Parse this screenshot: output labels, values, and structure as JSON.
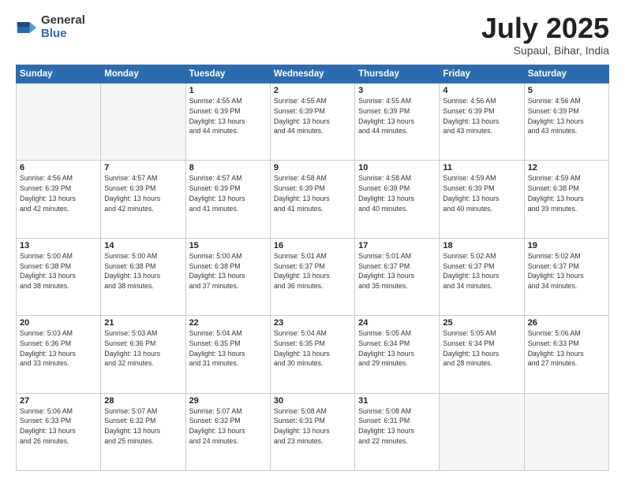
{
  "logo": {
    "general": "General",
    "blue": "Blue"
  },
  "title": {
    "month": "July 2025",
    "location": "Supaul, Bihar, India"
  },
  "weekdays": [
    "Sunday",
    "Monday",
    "Tuesday",
    "Wednesday",
    "Thursday",
    "Friday",
    "Saturday"
  ],
  "weeks": [
    [
      {
        "day": "",
        "info": ""
      },
      {
        "day": "",
        "info": ""
      },
      {
        "day": "1",
        "info": "Sunrise: 4:55 AM\nSunset: 6:39 PM\nDaylight: 13 hours\nand 44 minutes."
      },
      {
        "day": "2",
        "info": "Sunrise: 4:55 AM\nSunset: 6:39 PM\nDaylight: 13 hours\nand 44 minutes."
      },
      {
        "day": "3",
        "info": "Sunrise: 4:55 AM\nSunset: 6:39 PM\nDaylight: 13 hours\nand 44 minutes."
      },
      {
        "day": "4",
        "info": "Sunrise: 4:56 AM\nSunset: 6:39 PM\nDaylight: 13 hours\nand 43 minutes."
      },
      {
        "day": "5",
        "info": "Sunrise: 4:56 AM\nSunset: 6:39 PM\nDaylight: 13 hours\nand 43 minutes."
      }
    ],
    [
      {
        "day": "6",
        "info": "Sunrise: 4:56 AM\nSunset: 6:39 PM\nDaylight: 13 hours\nand 42 minutes."
      },
      {
        "day": "7",
        "info": "Sunrise: 4:57 AM\nSunset: 6:39 PM\nDaylight: 13 hours\nand 42 minutes."
      },
      {
        "day": "8",
        "info": "Sunrise: 4:57 AM\nSunset: 6:39 PM\nDaylight: 13 hours\nand 41 minutes."
      },
      {
        "day": "9",
        "info": "Sunrise: 4:58 AM\nSunset: 6:39 PM\nDaylight: 13 hours\nand 41 minutes."
      },
      {
        "day": "10",
        "info": "Sunrise: 4:58 AM\nSunset: 6:39 PM\nDaylight: 13 hours\nand 40 minutes."
      },
      {
        "day": "11",
        "info": "Sunrise: 4:59 AM\nSunset: 6:39 PM\nDaylight: 13 hours\nand 40 minutes."
      },
      {
        "day": "12",
        "info": "Sunrise: 4:59 AM\nSunset: 6:38 PM\nDaylight: 13 hours\nand 39 minutes."
      }
    ],
    [
      {
        "day": "13",
        "info": "Sunrise: 5:00 AM\nSunset: 6:38 PM\nDaylight: 13 hours\nand 38 minutes."
      },
      {
        "day": "14",
        "info": "Sunrise: 5:00 AM\nSunset: 6:38 PM\nDaylight: 13 hours\nand 38 minutes."
      },
      {
        "day": "15",
        "info": "Sunrise: 5:00 AM\nSunset: 6:38 PM\nDaylight: 13 hours\nand 37 minutes."
      },
      {
        "day": "16",
        "info": "Sunrise: 5:01 AM\nSunset: 6:37 PM\nDaylight: 13 hours\nand 36 minutes."
      },
      {
        "day": "17",
        "info": "Sunrise: 5:01 AM\nSunset: 6:37 PM\nDaylight: 13 hours\nand 35 minutes."
      },
      {
        "day": "18",
        "info": "Sunrise: 5:02 AM\nSunset: 6:37 PM\nDaylight: 13 hours\nand 34 minutes."
      },
      {
        "day": "19",
        "info": "Sunrise: 5:02 AM\nSunset: 6:37 PM\nDaylight: 13 hours\nand 34 minutes."
      }
    ],
    [
      {
        "day": "20",
        "info": "Sunrise: 5:03 AM\nSunset: 6:36 PM\nDaylight: 13 hours\nand 33 minutes."
      },
      {
        "day": "21",
        "info": "Sunrise: 5:03 AM\nSunset: 6:36 PM\nDaylight: 13 hours\nand 32 minutes."
      },
      {
        "day": "22",
        "info": "Sunrise: 5:04 AM\nSunset: 6:35 PM\nDaylight: 13 hours\nand 31 minutes."
      },
      {
        "day": "23",
        "info": "Sunrise: 5:04 AM\nSunset: 6:35 PM\nDaylight: 13 hours\nand 30 minutes."
      },
      {
        "day": "24",
        "info": "Sunrise: 5:05 AM\nSunset: 6:34 PM\nDaylight: 13 hours\nand 29 minutes."
      },
      {
        "day": "25",
        "info": "Sunrise: 5:05 AM\nSunset: 6:34 PM\nDaylight: 13 hours\nand 28 minutes."
      },
      {
        "day": "26",
        "info": "Sunrise: 5:06 AM\nSunset: 6:33 PM\nDaylight: 13 hours\nand 27 minutes."
      }
    ],
    [
      {
        "day": "27",
        "info": "Sunrise: 5:06 AM\nSunset: 6:33 PM\nDaylight: 13 hours\nand 26 minutes."
      },
      {
        "day": "28",
        "info": "Sunrise: 5:07 AM\nSunset: 6:32 PM\nDaylight: 13 hours\nand 25 minutes."
      },
      {
        "day": "29",
        "info": "Sunrise: 5:07 AM\nSunset: 6:32 PM\nDaylight: 13 hours\nand 24 minutes."
      },
      {
        "day": "30",
        "info": "Sunrise: 5:08 AM\nSunset: 6:31 PM\nDaylight: 13 hours\nand 23 minutes."
      },
      {
        "day": "31",
        "info": "Sunrise: 5:08 AM\nSunset: 6:31 PM\nDaylight: 13 hours\nand 22 minutes."
      },
      {
        "day": "",
        "info": ""
      },
      {
        "day": "",
        "info": ""
      }
    ]
  ]
}
